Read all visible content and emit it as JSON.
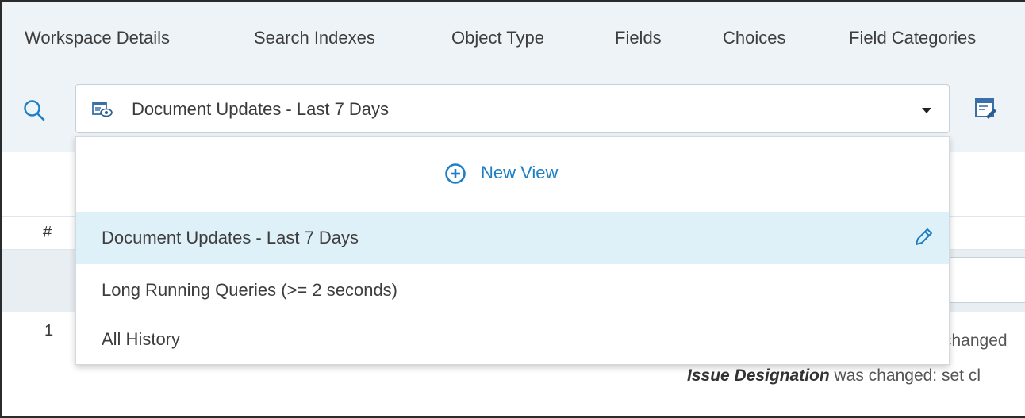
{
  "tabs": [
    {
      "label": "Workspace Details"
    },
    {
      "label": "Search Indexes"
    },
    {
      "label": "Object Type"
    },
    {
      "label": "Fields"
    },
    {
      "label": "Choices"
    },
    {
      "label": "Field Categories"
    }
  ],
  "toolbar": {
    "selected_view": "Document Updates - Last 7 Days"
  },
  "grid": {
    "column_hash": "#",
    "row_number": "1",
    "change_text_partial": "changed",
    "change_field": "Issue Designation",
    "change_rest": " was changed: set cl"
  },
  "dropdown": {
    "new_view_label": "New View",
    "items": [
      {
        "label": "Document Updates - Last 7 Days",
        "selected": true
      },
      {
        "label": "Long Running Queries (>= 2 seconds)",
        "selected": false
      },
      {
        "label": "All History",
        "selected": false
      }
    ]
  },
  "colors": {
    "accent": "#1e7fc6",
    "toolbar_bg": "#eef3f8",
    "selected_bg": "#dff1f8"
  },
  "icons": [
    "search-icon",
    "view-icon",
    "chevron-down-icon",
    "edit-view-icon",
    "plus-circle-icon",
    "pencil-icon"
  ]
}
